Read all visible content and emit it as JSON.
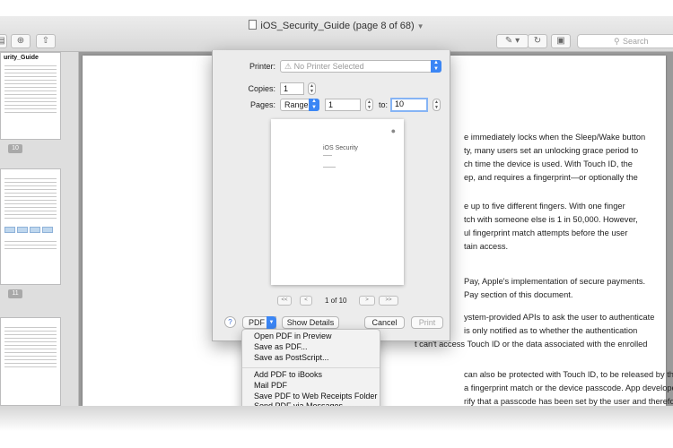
{
  "window": {
    "title": "iOS_Security_Guide (page 8 of 68)",
    "search_placeholder": "Search"
  },
  "sidebar": {
    "first_thumb_title": "urity_Guide",
    "page_numbers": [
      "10",
      "11"
    ]
  },
  "document": {
    "lines": [
      "e immediately locks when the Sleep/Wake button",
      "ty, many users set an unlocking grace period to",
      "ch time the device is used. With Touch ID, the",
      "ep, and requires a fingerprint—or optionally the",
      "e up to five different fingers. With one finger",
      "tch with someone else is 1 in 50,000. However,",
      "ul fingerprint match attempts before the user",
      "tain access.",
      "Pay, Apple's implementation of secure payments.",
      "Pay section of this document.",
      "ystem-provided APIs to ask the user to authenticate",
      "is only notified as to whether the authentication",
      "t can't access Touch ID or the data associated with the enrolled",
      "can also be protected with Touch ID, to be released by the Secure",
      "a fingerprint match or the device passcode. App developers also",
      "rify that a passcode has been set by the user and therefore able to"
    ]
  },
  "print_dialog": {
    "printer_label": "Printer:",
    "printer_value": "No Printer Selected",
    "copies_label": "Copies:",
    "copies_value": "1",
    "pages_label": "Pages:",
    "pages_mode": "Range",
    "pages_from": "1",
    "pages_to_label": "to:",
    "pages_to": "10",
    "preview_title": "iOS Security",
    "page_indicator": "1 of 10",
    "nav_first": "<<",
    "nav_prev": "<",
    "nav_next": ">",
    "nav_last": ">>",
    "help_label": "?",
    "pdf_label": "PDF",
    "show_details_label": "Show Details",
    "cancel_label": "Cancel",
    "print_label": "Print"
  },
  "pdf_menu": {
    "items_group1": [
      "Open PDF in Preview",
      "Save as PDF...",
      "Save as PostScript..."
    ],
    "items_group2": [
      "Add PDF to iBooks",
      "Mail PDF",
      "Save PDF to Web Receipts Folder",
      "Send PDF via Messages"
    ]
  }
}
